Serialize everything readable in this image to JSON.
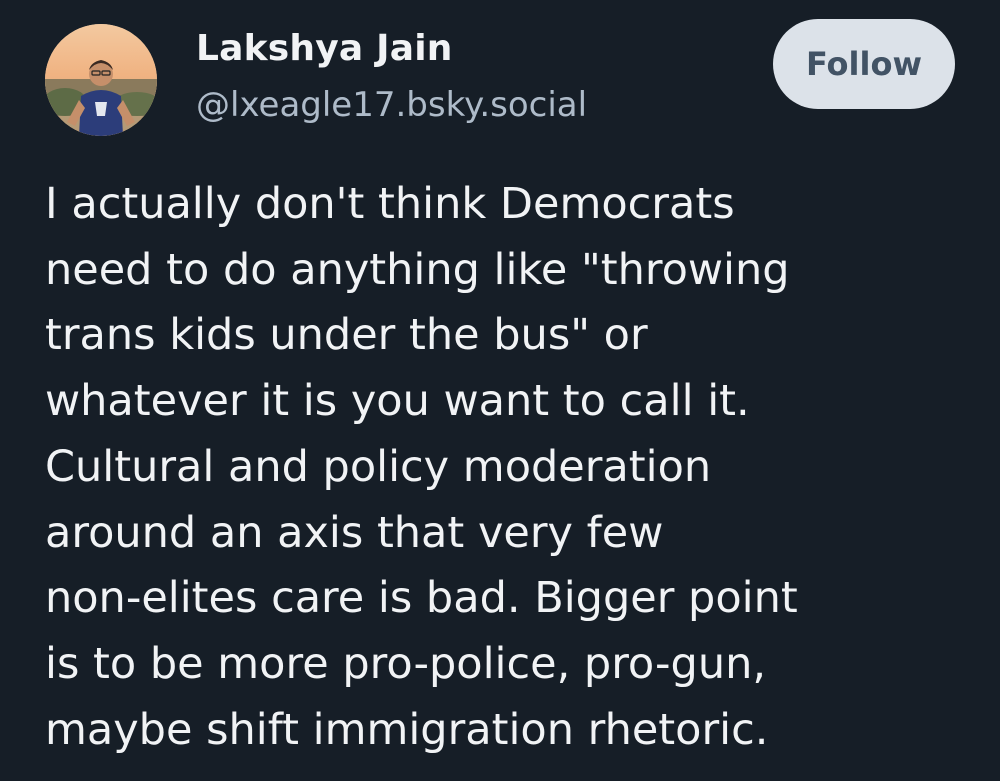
{
  "author": {
    "name": "Lakshya Jain",
    "handle": "@lxeagle17.bsky.social",
    "avatar_icon": "avatar-photo-icon"
  },
  "follow_label": "Follow",
  "post": {
    "lines": [
      "I actually don't think Democrats",
      "need to do anything like \"throwing",
      "trans kids under the bus\" or",
      "whatever it is you want to call it.",
      "Cultural and policy moderation",
      "around an axis that very few",
      "non-elites care is bad. Bigger point",
      "is to be more pro-police, pro-gun,",
      "maybe shift immigration rhetoric."
    ]
  },
  "colors": {
    "background": "#161e27",
    "text": "#f1f3f5",
    "handle": "#aebbc9",
    "follow_bg": "#dce2e9",
    "follow_text": "#425365"
  }
}
